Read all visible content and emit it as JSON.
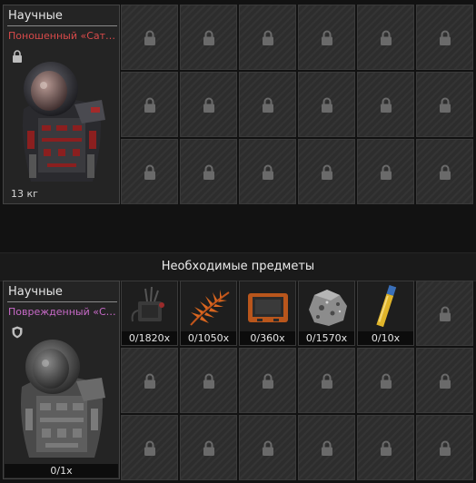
{
  "top_item": {
    "category": "Научные",
    "name": "Поношенный «Сатурн»",
    "name_display": "Поношенный «Сатур...",
    "weight": "13 кг",
    "name_color": "#d84a4a",
    "status_icon": "lock-icon"
  },
  "section_title": "Необходимые предметы",
  "bottom_item": {
    "category": "Научные",
    "name": "Поврежденный «Сатурн»",
    "name_display": "Поврежденный «Сат...",
    "count": "0/1x",
    "name_color": "#c86ac8",
    "status_icon": "shield-icon"
  },
  "required_items": [
    {
      "icon": "wired-component-icon",
      "count": "0/1820x"
    },
    {
      "icon": "orange-fern-icon",
      "count": "0/1050x"
    },
    {
      "icon": "orange-tablet-icon",
      "count": "0/360x"
    },
    {
      "icon": "ore-chunk-icon",
      "count": "0/1570x"
    },
    {
      "icon": "vial-icon",
      "count": "0/10x"
    }
  ],
  "locked_slot_icon": "padlock-icon"
}
